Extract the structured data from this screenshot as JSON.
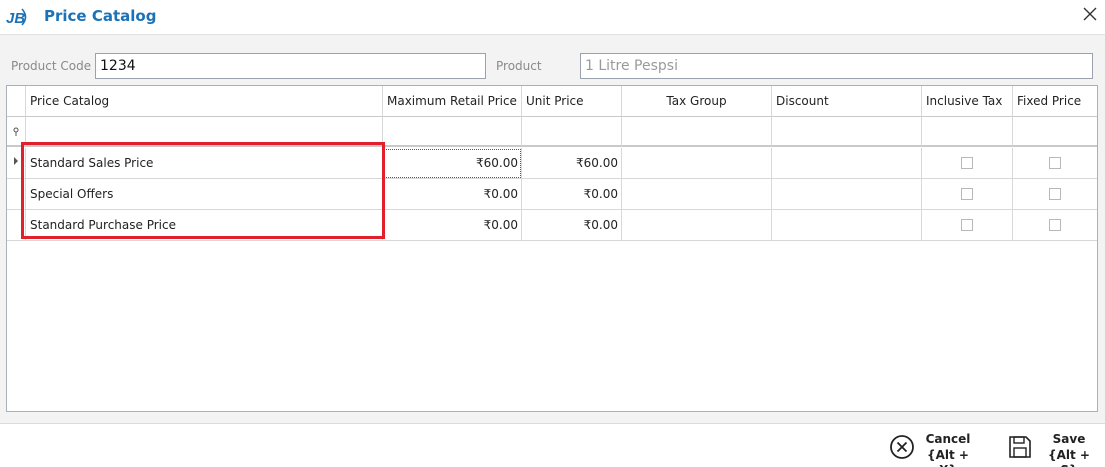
{
  "window": {
    "logo_text": "JB",
    "title": "Price Catalog",
    "close_icon": "close-icon"
  },
  "form": {
    "product_code_label": "Product Code",
    "product_code_value": "1234",
    "product_label": "Product",
    "product_value": "1 Litre Pespsi"
  },
  "grid": {
    "columns": [
      "Price Catalog",
      "Maximum Retail Price",
      "Unit Price",
      "Tax Group",
      "Discount",
      "Inclusive Tax",
      "Fixed Price"
    ],
    "filter_icon": "filter-icon",
    "current_row_icon": "row-pointer-icon",
    "rows": [
      {
        "catalog": "Standard Sales Price",
        "mrp": "₹60.00",
        "unit_price": "₹60.00",
        "tax_group": "",
        "discount": "",
        "inclusive_tax": false,
        "fixed_price": false
      },
      {
        "catalog": "Special Offers",
        "mrp": "₹0.00",
        "unit_price": "₹0.00",
        "tax_group": "",
        "discount": "",
        "inclusive_tax": false,
        "fixed_price": false
      },
      {
        "catalog": "Standard Purchase Price",
        "mrp": "₹0.00",
        "unit_price": "₹0.00",
        "tax_group": "",
        "discount": "",
        "inclusive_tax": false,
        "fixed_price": false
      }
    ],
    "highlight_color": "#e0202a"
  },
  "footer": {
    "cancel_label": "Cancel",
    "cancel_shortcut": "{Alt + X}",
    "save_label": "Save",
    "save_shortcut": "{Alt + S}"
  },
  "colors": {
    "accent": "#1b72b8",
    "panel_bg": "#f3f3f3"
  }
}
